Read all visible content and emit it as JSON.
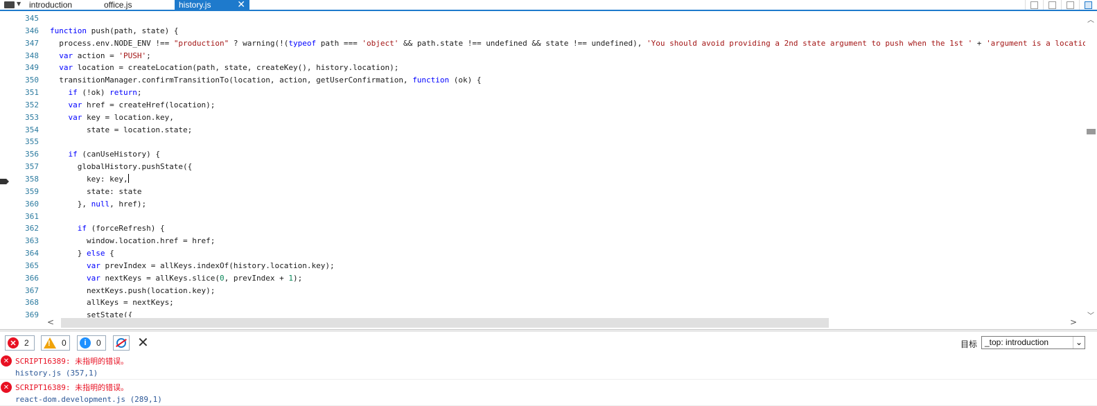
{
  "tabs": [
    {
      "label": "introduction",
      "active": false
    },
    {
      "label": "office.js",
      "active": false
    },
    {
      "label": "history.js",
      "active": true
    }
  ],
  "tab_close_glyph": "✕",
  "editor": {
    "lines": [
      {
        "num": "345",
        "html": ""
      },
      {
        "num": "346",
        "html": "<span class=\"k\">function</span> push(path, state) {"
      },
      {
        "num": "347",
        "html": "  process.env.NODE_ENV !== <span class=\"s\">\"production\"</span> ? warning(!(<span class=\"k\">typeof</span> path === <span class=\"s\">'object'</span> &amp;&amp; path.state !== undefined &amp;&amp; state !== undefined), <span class=\"s\">'You should avoid providing a 2nd state argument to push when the 1st '</span> + <span class=\"s\">'argument is a location-l</span>"
      },
      {
        "num": "348",
        "html": "  <span class=\"k\">var</span> action = <span class=\"s\">'PUSH'</span>;"
      },
      {
        "num": "349",
        "html": "  <span class=\"k\">var</span> location = createLocation(path, state, createKey(), history.location);"
      },
      {
        "num": "350",
        "html": "  transitionManager.confirmTransitionTo(location, action, getUserConfirmation, <span class=\"k\">function</span> (ok) {"
      },
      {
        "num": "351",
        "html": "    <span class=\"k\">if</span> (!ok) <span class=\"k\">return</span>;"
      },
      {
        "num": "352",
        "html": "    <span class=\"k\">var</span> href = createHref(location);"
      },
      {
        "num": "353",
        "html": "    <span class=\"k\">var</span> key = location.key,"
      },
      {
        "num": "354",
        "html": "        state = location.state;"
      },
      {
        "num": "355",
        "html": ""
      },
      {
        "num": "356",
        "html": "    <span class=\"k\">if</span> (canUseHistory) {"
      },
      {
        "num": "357",
        "html": "      globalHistory.pushState({"
      },
      {
        "num": "358",
        "html": "        key: key,<span class=\"caret\"></span>"
      },
      {
        "num": "359",
        "html": "        state: state"
      },
      {
        "num": "360",
        "html": "      }, <span class=\"k\">null</span>, href);"
      },
      {
        "num": "361",
        "html": ""
      },
      {
        "num": "362",
        "html": "      <span class=\"k\">if</span> (forceRefresh) {"
      },
      {
        "num": "363",
        "html": "        window.location.href = href;"
      },
      {
        "num": "364",
        "html": "      } <span class=\"k\">else</span> {"
      },
      {
        "num": "365",
        "html": "        <span class=\"k\">var</span> prevIndex = allKeys.indexOf(history.location.key);"
      },
      {
        "num": "366",
        "html": "        <span class=\"k\">var</span> nextKeys = allKeys.slice(<span class=\"n\">0</span>, prevIndex + <span class=\"n\">1</span>);"
      },
      {
        "num": "367",
        "html": "        nextKeys.push(location.key);"
      },
      {
        "num": "368",
        "html": "        allKeys = nextKeys;"
      },
      {
        "num": "369",
        "html": "        setState({"
      }
    ]
  },
  "console_toolbar": {
    "errors_count": "2",
    "warnings_count": "0",
    "info_count": "0",
    "error_glyph": "✕",
    "warn_glyph": "!",
    "info_glyph": "i",
    "clear_glyph": "✕",
    "target_label": "目标",
    "target_value": "_top: introduction",
    "target_chevron": "⌄"
  },
  "console_messages": [
    {
      "text": "SCRIPT16389: 未指明的错误。",
      "source": "history.js (357,1)"
    },
    {
      "text": "SCRIPT16389: 未指明的错误。",
      "source": "react-dom.development.js (289,1)"
    }
  ],
  "colors": {
    "accent": "#1e7acc",
    "error": "#e81123",
    "keyword": "#0000ff",
    "string": "#a31515",
    "line_number": "#2b7a9f"
  }
}
